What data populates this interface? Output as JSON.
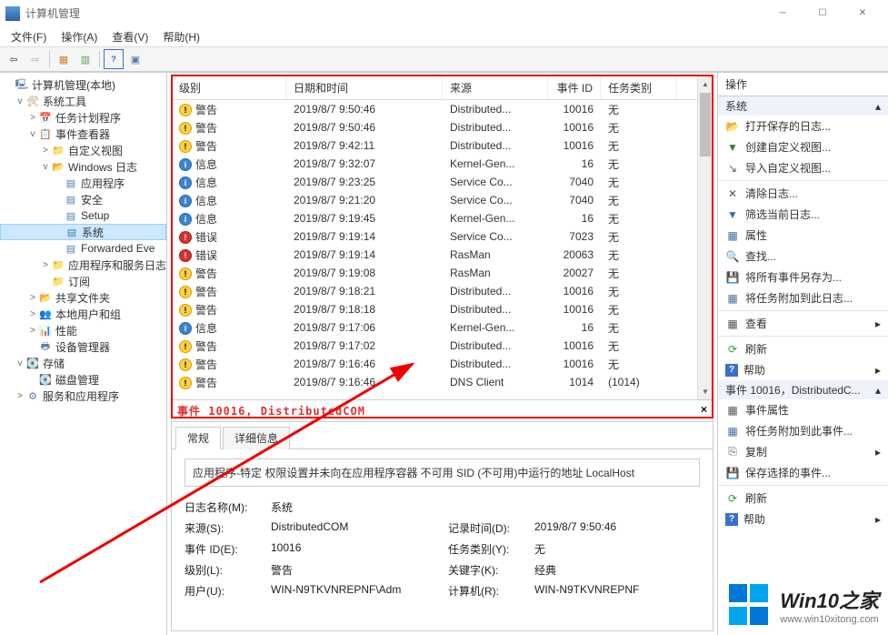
{
  "titlebar": {
    "title": "计算机管理"
  },
  "menubar": [
    "文件(F)",
    "操作(A)",
    "查看(V)",
    "帮助(H)"
  ],
  "tree": [
    {
      "ind": 0,
      "exp": "",
      "icon": "computer",
      "label": "计算机管理(本地)"
    },
    {
      "ind": 1,
      "exp": "v",
      "icon": "tool",
      "label": "系统工具"
    },
    {
      "ind": 2,
      "exp": ">",
      "icon": "clock",
      "label": "任务计划程序"
    },
    {
      "ind": 2,
      "exp": "v",
      "icon": "book",
      "label": "事件查看器"
    },
    {
      "ind": 3,
      "exp": ">",
      "icon": "folder",
      "label": "自定义视图"
    },
    {
      "ind": 3,
      "exp": "v",
      "icon": "folder-o",
      "label": "Windows 日志"
    },
    {
      "ind": 4,
      "exp": "",
      "icon": "log",
      "label": "应用程序"
    },
    {
      "ind": 4,
      "exp": "",
      "icon": "log",
      "label": "安全"
    },
    {
      "ind": 4,
      "exp": "",
      "icon": "log",
      "label": "Setup"
    },
    {
      "ind": 4,
      "exp": "",
      "icon": "log",
      "label": "系统",
      "sel": true
    },
    {
      "ind": 4,
      "exp": "",
      "icon": "log",
      "label": "Forwarded Eve"
    },
    {
      "ind": 3,
      "exp": ">",
      "icon": "folder",
      "label": "应用程序和服务日志"
    },
    {
      "ind": 3,
      "exp": "",
      "icon": "folder",
      "label": "订阅"
    },
    {
      "ind": 2,
      "exp": ">",
      "icon": "share",
      "label": "共享文件夹"
    },
    {
      "ind": 2,
      "exp": ">",
      "icon": "users",
      "label": "本地用户和组"
    },
    {
      "ind": 2,
      "exp": ">",
      "icon": "perf",
      "label": "性能"
    },
    {
      "ind": 2,
      "exp": "",
      "icon": "dev",
      "label": "设备管理器"
    },
    {
      "ind": 1,
      "exp": "v",
      "icon": "disk",
      "label": "存储"
    },
    {
      "ind": 2,
      "exp": "",
      "icon": "disk",
      "label": "磁盘管理"
    },
    {
      "ind": 1,
      "exp": ">",
      "icon": "svc",
      "label": "服务和应用程序"
    }
  ],
  "grid": {
    "headers": {
      "level": "级别",
      "date": "日期和时间",
      "src": "来源",
      "id": "事件 ID",
      "cat": "任务类别"
    },
    "rows": [
      {
        "lvl": "warn",
        "level": "警告",
        "date": "2019/8/7 9:50:46",
        "src": "Distributed...",
        "id": "10016",
        "cat": "无"
      },
      {
        "lvl": "warn",
        "level": "警告",
        "date": "2019/8/7 9:50:46",
        "src": "Distributed...",
        "id": "10016",
        "cat": "无"
      },
      {
        "lvl": "warn",
        "level": "警告",
        "date": "2019/8/7 9:42:11",
        "src": "Distributed...",
        "id": "10016",
        "cat": "无"
      },
      {
        "lvl": "info",
        "level": "信息",
        "date": "2019/8/7 9:32:07",
        "src": "Kernel-Gen...",
        "id": "16",
        "cat": "无"
      },
      {
        "lvl": "info",
        "level": "信息",
        "date": "2019/8/7 9:23:25",
        "src": "Service Co...",
        "id": "7040",
        "cat": "无"
      },
      {
        "lvl": "info",
        "level": "信息",
        "date": "2019/8/7 9:21:20",
        "src": "Service Co...",
        "id": "7040",
        "cat": "无"
      },
      {
        "lvl": "info",
        "level": "信息",
        "date": "2019/8/7 9:19:45",
        "src": "Kernel-Gen...",
        "id": "16",
        "cat": "无"
      },
      {
        "lvl": "err",
        "level": "错误",
        "date": "2019/8/7 9:19:14",
        "src": "Service Co...",
        "id": "7023",
        "cat": "无"
      },
      {
        "lvl": "err",
        "level": "错误",
        "date": "2019/8/7 9:19:14",
        "src": "RasMan",
        "id": "20063",
        "cat": "无"
      },
      {
        "lvl": "warn",
        "level": "警告",
        "date": "2019/8/7 9:19:08",
        "src": "RasMan",
        "id": "20027",
        "cat": "无"
      },
      {
        "lvl": "warn",
        "level": "警告",
        "date": "2019/8/7 9:18:21",
        "src": "Distributed...",
        "id": "10016",
        "cat": "无"
      },
      {
        "lvl": "warn",
        "level": "警告",
        "date": "2019/8/7 9:18:18",
        "src": "Distributed...",
        "id": "10016",
        "cat": "无"
      },
      {
        "lvl": "info",
        "level": "信息",
        "date": "2019/8/7 9:17:06",
        "src": "Kernel-Gen...",
        "id": "16",
        "cat": "无"
      },
      {
        "lvl": "warn",
        "level": "警告",
        "date": "2019/8/7 9:17:02",
        "src": "Distributed...",
        "id": "10016",
        "cat": "无"
      },
      {
        "lvl": "warn",
        "level": "警告",
        "date": "2019/8/7 9:16:46",
        "src": "Distributed...",
        "id": "10016",
        "cat": "无"
      },
      {
        "lvl": "warn",
        "level": "警告",
        "date": "2019/8/7 9:16:46",
        "src": "DNS Client",
        "id": "1014",
        "cat": "(1014)"
      }
    ]
  },
  "mid": {
    "title": "事件 10016, DistributedCOM",
    "close": "×"
  },
  "detail": {
    "tabs": {
      "general": "常规",
      "detail": "详细信息"
    },
    "msg": "应用程序-特定 权限设置并未向在应用程序容器 不可用 SID (不可用)中运行的地址 LocalHost",
    "labels": {
      "log": "日志名称(M):",
      "src": "来源(S):",
      "id": "事件 ID(E):",
      "lvl": "级别(L):",
      "user": "用户(U):",
      "time": "记录时间(D):",
      "cat": "任务类别(Y):",
      "kw": "关键字(K):",
      "comp": "计算机(R):"
    },
    "values": {
      "log": "系统",
      "src": "DistributedCOM",
      "id": "10016",
      "lvl": "警告",
      "user": "WIN-N9TKVNREPNF\\Adm",
      "time": "2019/8/7 9:50:46",
      "cat": "无",
      "kw": "经典",
      "comp": "WIN-N9TKVNREPNF"
    }
  },
  "actions": {
    "title": "操作",
    "section1": "系统",
    "section2": "事件 10016，DistributedC...",
    "list1": [
      {
        "ic": "ai-open",
        "t": "打开保存的日志..."
      },
      {
        "ic": "ai-view",
        "t": "创建自定义视图..."
      },
      {
        "ic": "ai-import",
        "t": "导入自定义视图..."
      },
      {
        "sep": true
      },
      {
        "ic": "ai-clear",
        "t": "清除日志..."
      },
      {
        "ic": "ai-filter",
        "t": "筛选当前日志..."
      },
      {
        "ic": "ai-prop",
        "t": "属性"
      },
      {
        "ic": "ai-find",
        "t": "查找..."
      },
      {
        "ic": "ai-save",
        "t": "将所有事件另存为..."
      },
      {
        "ic": "ai-attach",
        "t": "将任务附加到此日志..."
      },
      {
        "sep": true
      },
      {
        "ic": "ai-thumb",
        "t": "查看",
        "arrow": "▸"
      },
      {
        "sep": true
      },
      {
        "ic": "ai-refresh",
        "t": "刷新"
      },
      {
        "ic": "ai-help",
        "t": "帮助",
        "arrow": "▸"
      }
    ],
    "list2": [
      {
        "ic": "ai-evprop",
        "t": "事件属性"
      },
      {
        "ic": "ai-attach",
        "t": "将任务附加到此事件..."
      },
      {
        "ic": "ai-copy",
        "t": "复制",
        "arrow": "▸"
      },
      {
        "ic": "ai-save",
        "t": "保存选择的事件..."
      },
      {
        "sep": true
      },
      {
        "ic": "ai-refresh",
        "t": "刷新"
      },
      {
        "ic": "ai-help",
        "t": "帮助",
        "arrow": "▸"
      }
    ]
  },
  "watermark": {
    "t1": "Win10之家",
    "t2": "www.win10xitong.com"
  }
}
